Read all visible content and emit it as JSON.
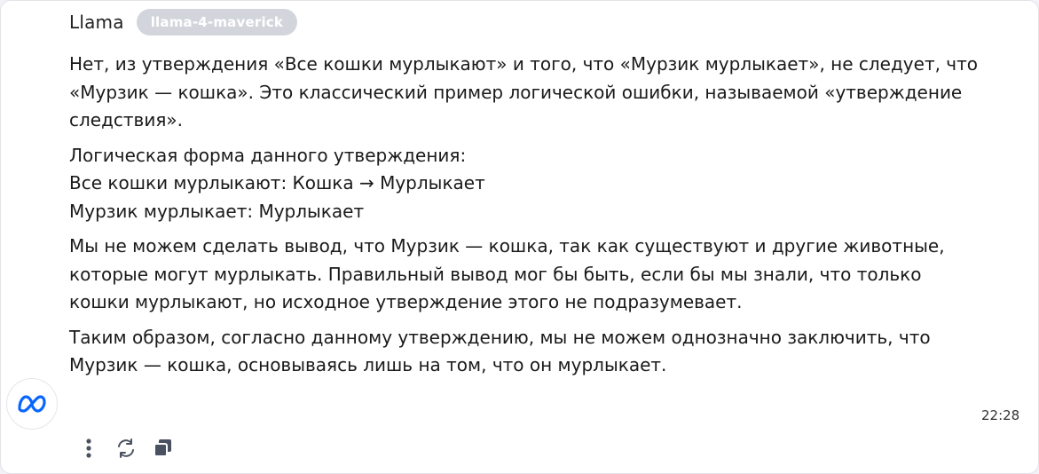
{
  "header": {
    "sender_name": "Llama",
    "model_badge": "llama-4-maverick"
  },
  "message": {
    "paragraphs": [
      "Нет, из утверждения «Все кошки мурлыкают» и того, что «Мурзик мурлыкает», не следует, что «Мурзик — кошка». Это классический пример логической ошибки, называемой «утверждение следствия».",
      "Логическая форма данного утверждения:\nВсе кошки мурлыкают: Кошка → Мурлыкает\nМурзик мурлыкает: Мурлыкает",
      "Мы не можем сделать вывод, что Мурзик — кошка, так как существуют и другие животные, которые могут мурлыкать. Правильный вывод мог бы быть, если бы мы знали, что только кошки мурлыкают, но исходное утверждение этого не подразумевает.",
      "Таким образом, согласно данному утверждению, мы не можем однозначно заключить, что Мурзик — кошка, основываясь лишь на том, что он мурлыкает."
    ],
    "timestamp": "22:28"
  },
  "avatar": {
    "icon": "meta-logo-icon",
    "color": "#0866ff"
  },
  "toolbar": {
    "icons": [
      "more-vertical-icon",
      "regenerate-icon",
      "copy-icon"
    ]
  }
}
